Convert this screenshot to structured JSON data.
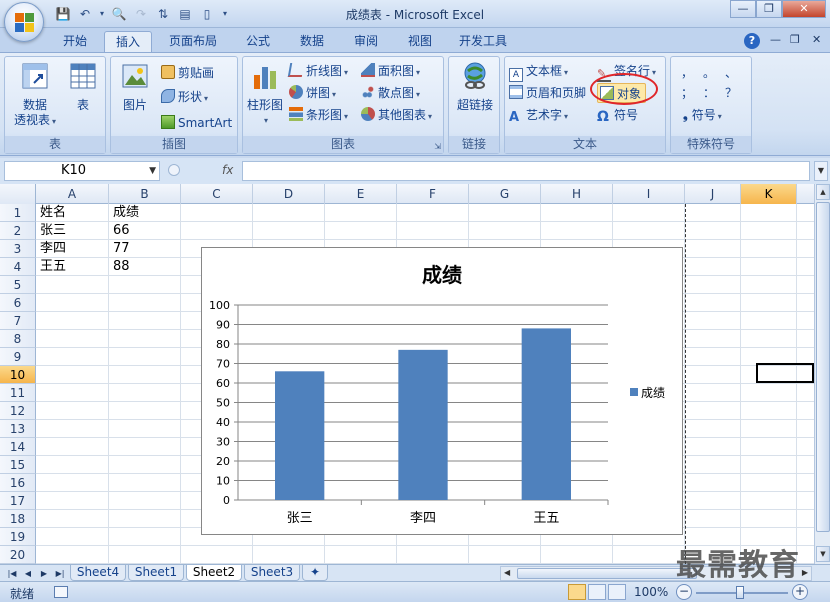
{
  "window": {
    "title": "成绩表 - Microsoft Excel",
    "minimize": "—",
    "maximize": "❐",
    "close": "✕"
  },
  "tabs": [
    "开始",
    "插入",
    "页面布局",
    "公式",
    "数据",
    "审阅",
    "视图",
    "开发工具"
  ],
  "active_tab": "插入",
  "ribbon": {
    "groups": {
      "table": {
        "label": "表",
        "pivot": "数据\n透视表",
        "pivot_line1": "数据",
        "pivot_line2": "透视表",
        "table": "表"
      },
      "illustrations": {
        "label": "插图",
        "picture": "图片",
        "clipart": "剪贴画",
        "shapes": "形状",
        "smartart": "SmartArt"
      },
      "charts": {
        "label": "图表",
        "column": "柱形图",
        "line": "折线图",
        "pie": "饼图",
        "bar": "条形图",
        "area": "面积图",
        "scatter": "散点图",
        "other": "其他图表"
      },
      "links": {
        "label": "链接",
        "hyperlink": "超链接"
      },
      "text": {
        "label": "文本",
        "textbox": "文本框",
        "header_footer": "页眉和页脚",
        "wordart": "艺术字",
        "signature": "签名行",
        "object": "对象",
        "symbol": "符号"
      },
      "special": {
        "label": "特殊符号",
        "symbols": [
          "，",
          "。",
          "、",
          "；",
          "：",
          "？"
        ],
        "symbol_btn": "符号"
      }
    }
  },
  "formula_bar": {
    "namebox": "K10",
    "fx": "fx",
    "value": ""
  },
  "columns": [
    "A",
    "B",
    "C",
    "D",
    "E",
    "F",
    "G",
    "H",
    "I",
    "J",
    "K"
  ],
  "selected_column": "K",
  "rows": [
    "1",
    "2",
    "3",
    "4",
    "5",
    "6",
    "7",
    "8",
    "9",
    "10",
    "11",
    "12",
    "13",
    "14",
    "15",
    "16",
    "17",
    "18",
    "19",
    "20"
  ],
  "selected_row": "10",
  "cells": {
    "A1": "姓名",
    "B1": "成绩",
    "A2": "张三",
    "B2": "66",
    "A3": "李四",
    "B3": "77",
    "A4": "王五",
    "B4": "88"
  },
  "chart_data": {
    "type": "bar",
    "title": "成绩",
    "categories": [
      "张三",
      "李四",
      "王五"
    ],
    "series": [
      {
        "name": "成绩",
        "values": [
          66,
          77,
          88
        ],
        "color": "#4f81bd"
      }
    ],
    "ylim": [
      0,
      100
    ],
    "yticks": [
      0,
      10,
      20,
      30,
      40,
      50,
      60,
      70,
      80,
      90,
      100
    ],
    "grid": true,
    "legend": "right"
  },
  "sheets": [
    "Sheet4",
    "Sheet1",
    "Sheet2",
    "Sheet3"
  ],
  "active_sheet": "Sheet2",
  "status": {
    "ready": "就绪",
    "zoom": "100%"
  },
  "watermark": "最需教育"
}
